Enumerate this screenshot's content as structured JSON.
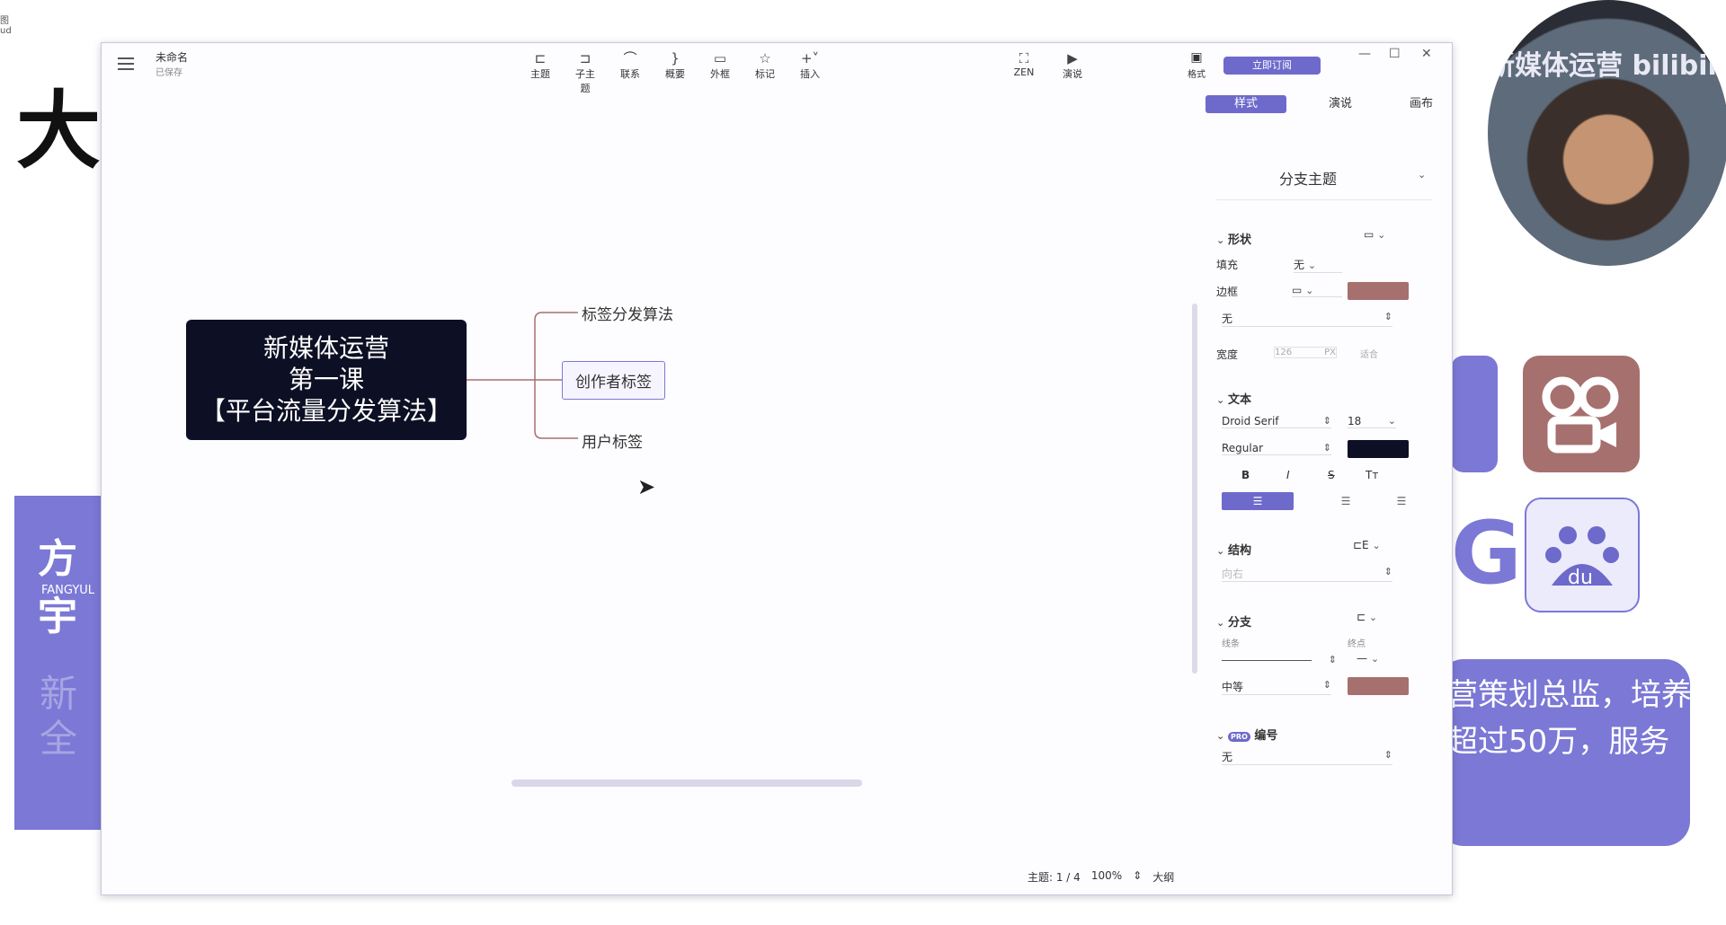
{
  "background": {
    "big_char": "大",
    "card_name": "方宇",
    "card_pinyin": "FANGYUL",
    "card_faded": [
      "新",
      "全"
    ],
    "right_lines": [
      "营策划总监，培养",
      "超过50万，服务"
    ],
    "cam_text": "新媒体运营 bilibili"
  },
  "window": {
    "doc_title": "未命名",
    "doc_sub": "已保存",
    "toolbar": [
      {
        "icon": "topic-icon",
        "glyph": "⊏",
        "label": "主题"
      },
      {
        "icon": "subtopic-icon",
        "glyph": "⊐",
        "label": "子主题"
      },
      {
        "icon": "relationship-icon",
        "glyph": "⌒",
        "label": "联系"
      },
      {
        "icon": "summary-icon",
        "glyph": "}",
        "label": "概要"
      },
      {
        "icon": "boundary-icon",
        "glyph": "▭",
        "label": "外框"
      },
      {
        "icon": "marker-icon",
        "glyph": "☆",
        "label": "标记"
      },
      {
        "icon": "insert-icon",
        "glyph": "+˅",
        "label": "插入"
      }
    ],
    "toolbar_right": [
      {
        "icon": "zen-icon",
        "glyph": "⛶",
        "label": "ZEN"
      },
      {
        "icon": "presentation-icon",
        "glyph": "▶",
        "label": "演说"
      }
    ],
    "panel_toggle_label": "格式",
    "subscribe_label": "立即订阅",
    "side_tabs": [
      "样式",
      "演说",
      "画布"
    ]
  },
  "mindmap": {
    "central": [
      "新媒体运营",
      "第一课",
      "【平台流量分发算法】"
    ],
    "subtopics": [
      "标签分发算法",
      "创作者标签",
      "用户标签"
    ]
  },
  "status": {
    "topic_count": "主题: 1 / 4",
    "zoom": "100%",
    "outline": "大纲"
  },
  "panel": {
    "style_title": "分支主题",
    "shape_label": "形状",
    "fill_label": "填充",
    "fill_value": "无",
    "border_label": "边框",
    "border_style": "无",
    "width_label": "宽度",
    "width_value": "126",
    "width_unit": "PX",
    "width_fit": "适合",
    "text_label": "文本",
    "font": "Droid Serif",
    "font_size": "18",
    "font_weight": "Regular",
    "text_styles": [
      "B",
      "I",
      "S",
      "Tт"
    ],
    "structure_label": "结构",
    "structure_value": "向右",
    "branch_label": "分支",
    "line_label": "线条",
    "endpoint_label": "终点",
    "line_width": "中等",
    "numbering_label": "编号",
    "numbering_value": "无",
    "pro_badge": "PRO",
    "colors": {
      "accent": "#6d6acb",
      "border_color": "#a6706e",
      "text_color": "#0d0f24",
      "branch_color": "#a6706e"
    }
  }
}
